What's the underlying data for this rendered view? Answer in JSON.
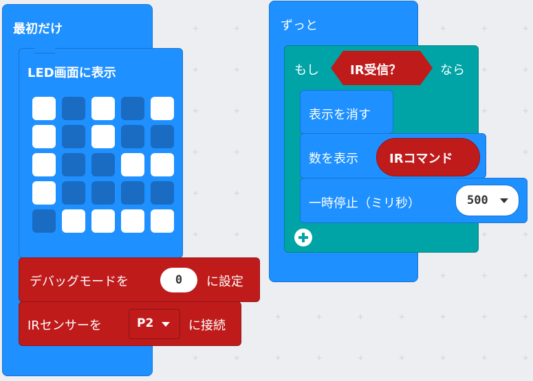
{
  "on_start": {
    "label": "最初だけ"
  },
  "show_leds": {
    "label": "LED画面に表示",
    "grid": [
      [
        1,
        0,
        1,
        0,
        1
      ],
      [
        1,
        0,
        1,
        0,
        0
      ],
      [
        1,
        0,
        0,
        1,
        1
      ],
      [
        1,
        0,
        0,
        0,
        0
      ],
      [
        0,
        1,
        1,
        1,
        1
      ]
    ]
  },
  "debug_mode": {
    "label_pre": "デバッグモードを",
    "value": "0",
    "label_post": "に設定"
  },
  "ir_connect": {
    "label_pre": "IRセンサーを",
    "pin": "P2",
    "label_post": "に接続"
  },
  "forever": {
    "label": "ずっと"
  },
  "if_block": {
    "label_if": "もし",
    "condition": "IR受信？",
    "label_then": "なら"
  },
  "clear_screen": {
    "label": "表示を消す"
  },
  "show_number": {
    "label": "数を表示",
    "value": "IRコマンド"
  },
  "pause": {
    "label": "一時停止（ミリ秒）",
    "value": "500"
  },
  "colors": {
    "basic": "#1e90ff",
    "logic": "#00a4a6",
    "ir": "#bf1b1b"
  }
}
